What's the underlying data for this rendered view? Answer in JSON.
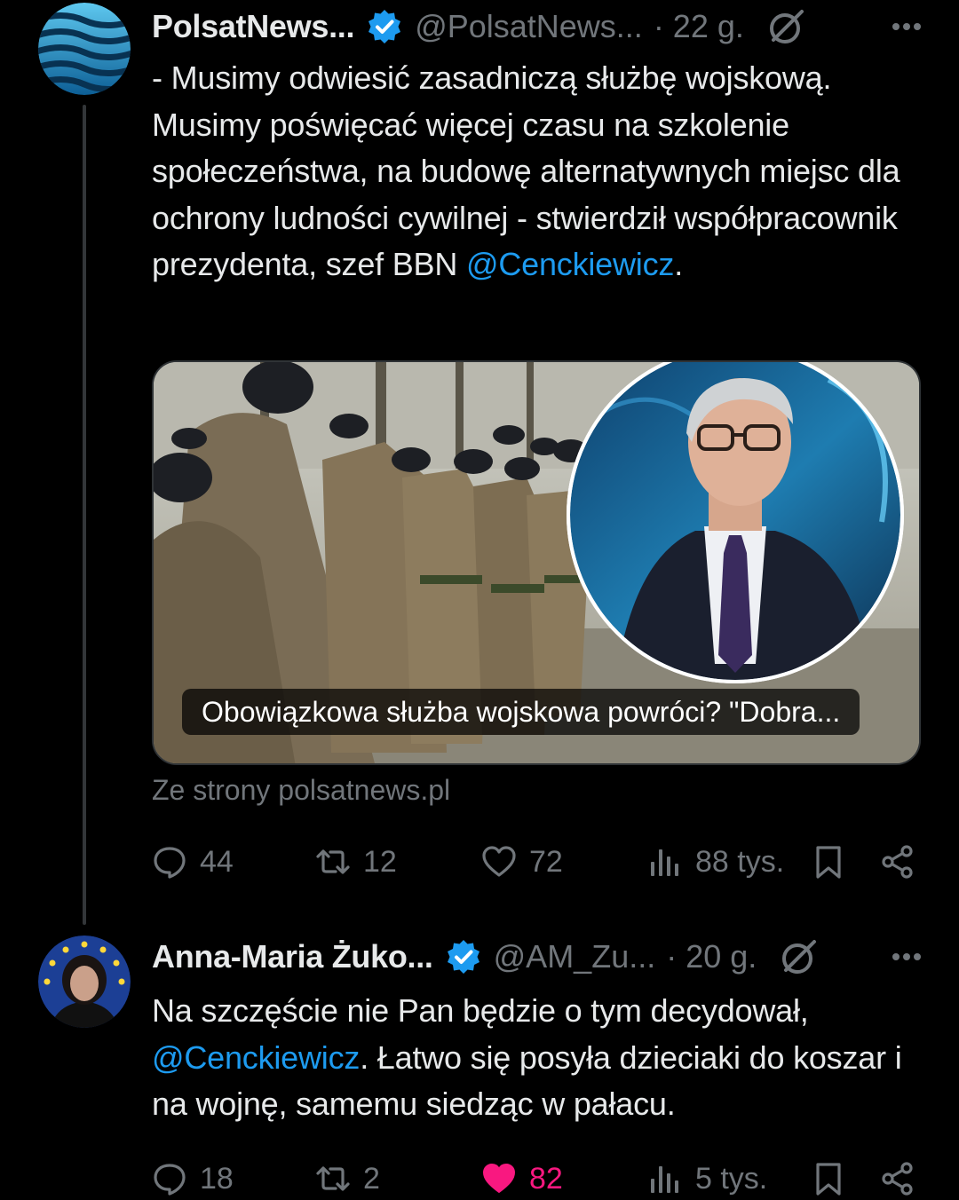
{
  "tweets": [
    {
      "name": "PolsatNews...",
      "handle": "@PolsatNews...",
      "time": "· 22 g.",
      "text_before": "- Musimy odwiesić zasadniczą służbę wojskową. Musimy poświęcać więcej czasu na szkolenie społeczeństwa, na budowę alternatywnych miejsc dla ochrony ludności cywilnej - stwierdził współpracownik prezydenta, szef BBN ",
      "mention": "@Cenckiewicz",
      "text_after": ".",
      "card": {
        "caption": "Obowiązkowa służba wojskowa powróci? \"Dobra...",
        "source": "Ze strony polsatnews.pl"
      },
      "stats": {
        "replies": "44",
        "reposts": "12",
        "likes": "72",
        "views": "88 tys."
      },
      "liked": false
    },
    {
      "name": "Anna-Maria Żuko...",
      "handle": "@AM_Zu...",
      "time": "· 20 g.",
      "text_before": "Na szczęście nie Pan będzie o tym decydował, ",
      "mention": "@Cenckiewicz",
      "text_after": ". Łatwo się posyła dzieciaki do koszar i na wojnę, samemu siedząc w pałacu.",
      "stats": {
        "replies": "18",
        "reposts": "2",
        "likes": "82",
        "views": "5 tys."
      },
      "liked": true
    }
  ],
  "colors": {
    "background": "#000000",
    "text": "#e7e9ea",
    "secondary": "#71767b",
    "link": "#1d9bf0",
    "like_active": "#f91880",
    "verified": "#1d9bf0"
  },
  "icons": [
    "reply-icon",
    "repost-icon",
    "like-icon",
    "views-icon",
    "bookmark-icon",
    "share-icon",
    "verified-badge-icon",
    "grok-icon",
    "more-icon"
  ]
}
